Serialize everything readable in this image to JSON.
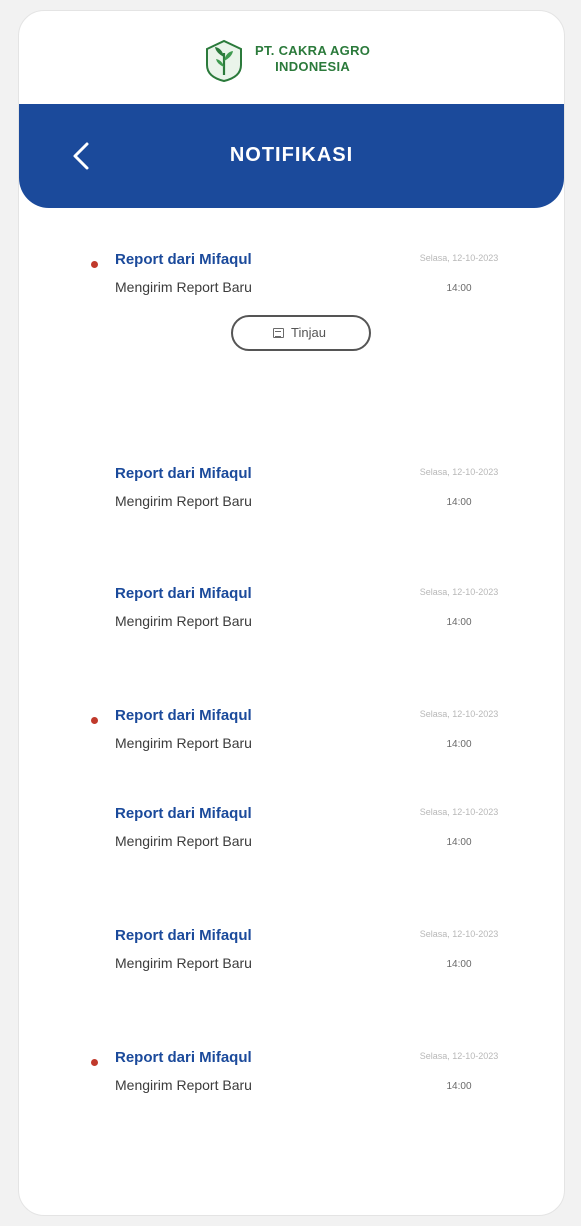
{
  "brand": {
    "line1": "PT. CAKRA AGRO",
    "line2": "INDONESIA",
    "color": "#2b7a3b"
  },
  "header": {
    "title": "NOTIFIKASI",
    "background": "#1b4a9b"
  },
  "icons": {
    "back": "chevron-left-icon",
    "logo": "leaf-logo-icon",
    "view": "document-icon"
  },
  "notifications": [
    {
      "title": "Report dari Mifaqul",
      "message": "Mengirim Report Baru",
      "date": "Selasa, 12-10-2023",
      "time": "14:00",
      "unread": true
    },
    {
      "title": "Report dari Mifaqul",
      "message": "Mengirim Report Baru",
      "date": "Selasa, 12-10-2023",
      "time": "14:00",
      "unread": false
    },
    {
      "title": "Report dari Mifaqul",
      "message": "Mengirim Report Baru",
      "date": "Selasa, 12-10-2023",
      "time": "14:00",
      "unread": false
    },
    {
      "title": "Report dari Mifaqul",
      "message": "Mengirim Report Baru",
      "date": "Selasa, 12-10-2023",
      "time": "14:00",
      "unread": true
    },
    {
      "title": "Report dari Mifaqul",
      "message": "Mengirim Report Baru",
      "date": "Selasa, 12-10-2023",
      "time": "14:00",
      "unread": false
    },
    {
      "title": "Report dari Mifaqul",
      "message": "Mengirim Report Baru",
      "date": "Selasa, 12-10-2023",
      "time": "14:00",
      "unread": false
    },
    {
      "title": "Report dari Mifaqul",
      "message": "Mengirim Report Baru",
      "date": "Selasa, 12-10-2023",
      "time": "14:00",
      "unread": true
    }
  ],
  "view_button": {
    "label": "Tinjau"
  },
  "colors": {
    "unread_dot": "#c0392b",
    "title_text": "#1b4a9b"
  }
}
